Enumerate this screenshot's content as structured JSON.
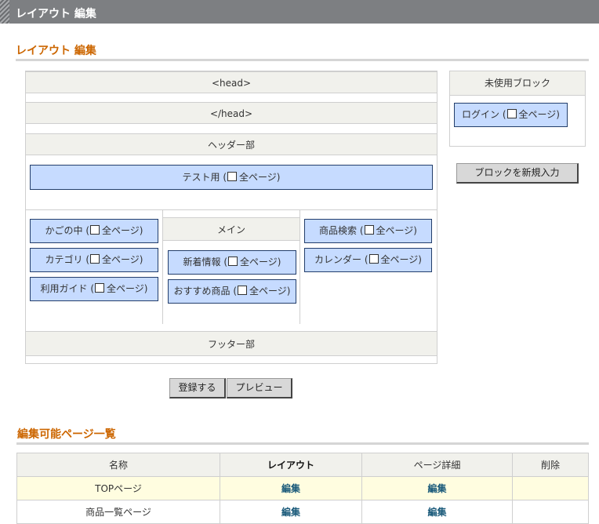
{
  "header": {
    "title": "レイアウト 編集"
  },
  "layout_section": {
    "title": "レイアウト 編集"
  },
  "layout": {
    "head_open": "<head>",
    "head_close": "</head>",
    "header_area": "ヘッダー部",
    "footer_area": "フッター部",
    "main_label": "メイン",
    "header_blocks": [
      {
        "label": "テスト用 (",
        "check_label": "全ページ)"
      }
    ],
    "left_blocks": [
      {
        "label": "かごの中 (",
        "check_label": "全ページ)"
      },
      {
        "label": "カテゴリ (",
        "check_label": "全ページ)"
      },
      {
        "label": "利用ガイド (",
        "check_label": "全ページ)"
      }
    ],
    "center_blocks": [
      {
        "label": "新着情報 (",
        "check_label": "全ページ)"
      },
      {
        "label": "おすすめ商品 (",
        "check_label": "全ページ)"
      }
    ],
    "right_blocks": [
      {
        "label": "商品検索 (",
        "check_label": "全ページ)"
      },
      {
        "label": "カレンダー (",
        "check_label": "全ページ)"
      }
    ]
  },
  "unused": {
    "title": "未使用ブロック",
    "blocks": [
      {
        "label": "ログイン (",
        "check_label": "全ページ)"
      }
    ]
  },
  "buttons": {
    "new_block": "ブロックを新規入力",
    "register": "登録する",
    "preview": "プレビュー"
  },
  "pages_section": {
    "title": "編集可能ページ一覧",
    "columns": [
      "名称",
      "レイアウト",
      "ページ詳細",
      "削除"
    ],
    "rows": [
      {
        "name": "TOPページ",
        "layout": "編集",
        "detail": "編集",
        "delete": ""
      },
      {
        "name": "商品一覧ページ",
        "layout": "編集",
        "detail": "編集",
        "delete": ""
      }
    ]
  },
  "colors": {
    "block_bg": "#c6dbff",
    "block_border": "#233e6b",
    "accent": "#cc6600",
    "band_bg": "#f1f1ec",
    "highlight_row": "#fffde0"
  }
}
